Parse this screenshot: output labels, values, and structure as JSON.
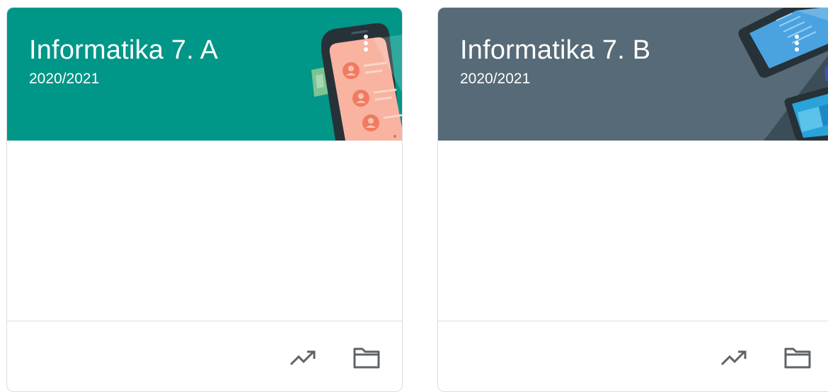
{
  "classes": [
    {
      "title": "Informatika 7. A",
      "section": "2020/2021",
      "theme_color": "#009688",
      "illustration": "phone-contacts-illustration",
      "icons": [
        "more-vert-icon",
        "trending-up-icon",
        "folder-icon"
      ]
    },
    {
      "title": "Informatika 7. B",
      "section": "2020/2021",
      "theme_color": "#576a77",
      "illustration": "devices-illustration",
      "icons": [
        "more-vert-icon",
        "trending-up-icon",
        "folder-icon"
      ]
    }
  ]
}
